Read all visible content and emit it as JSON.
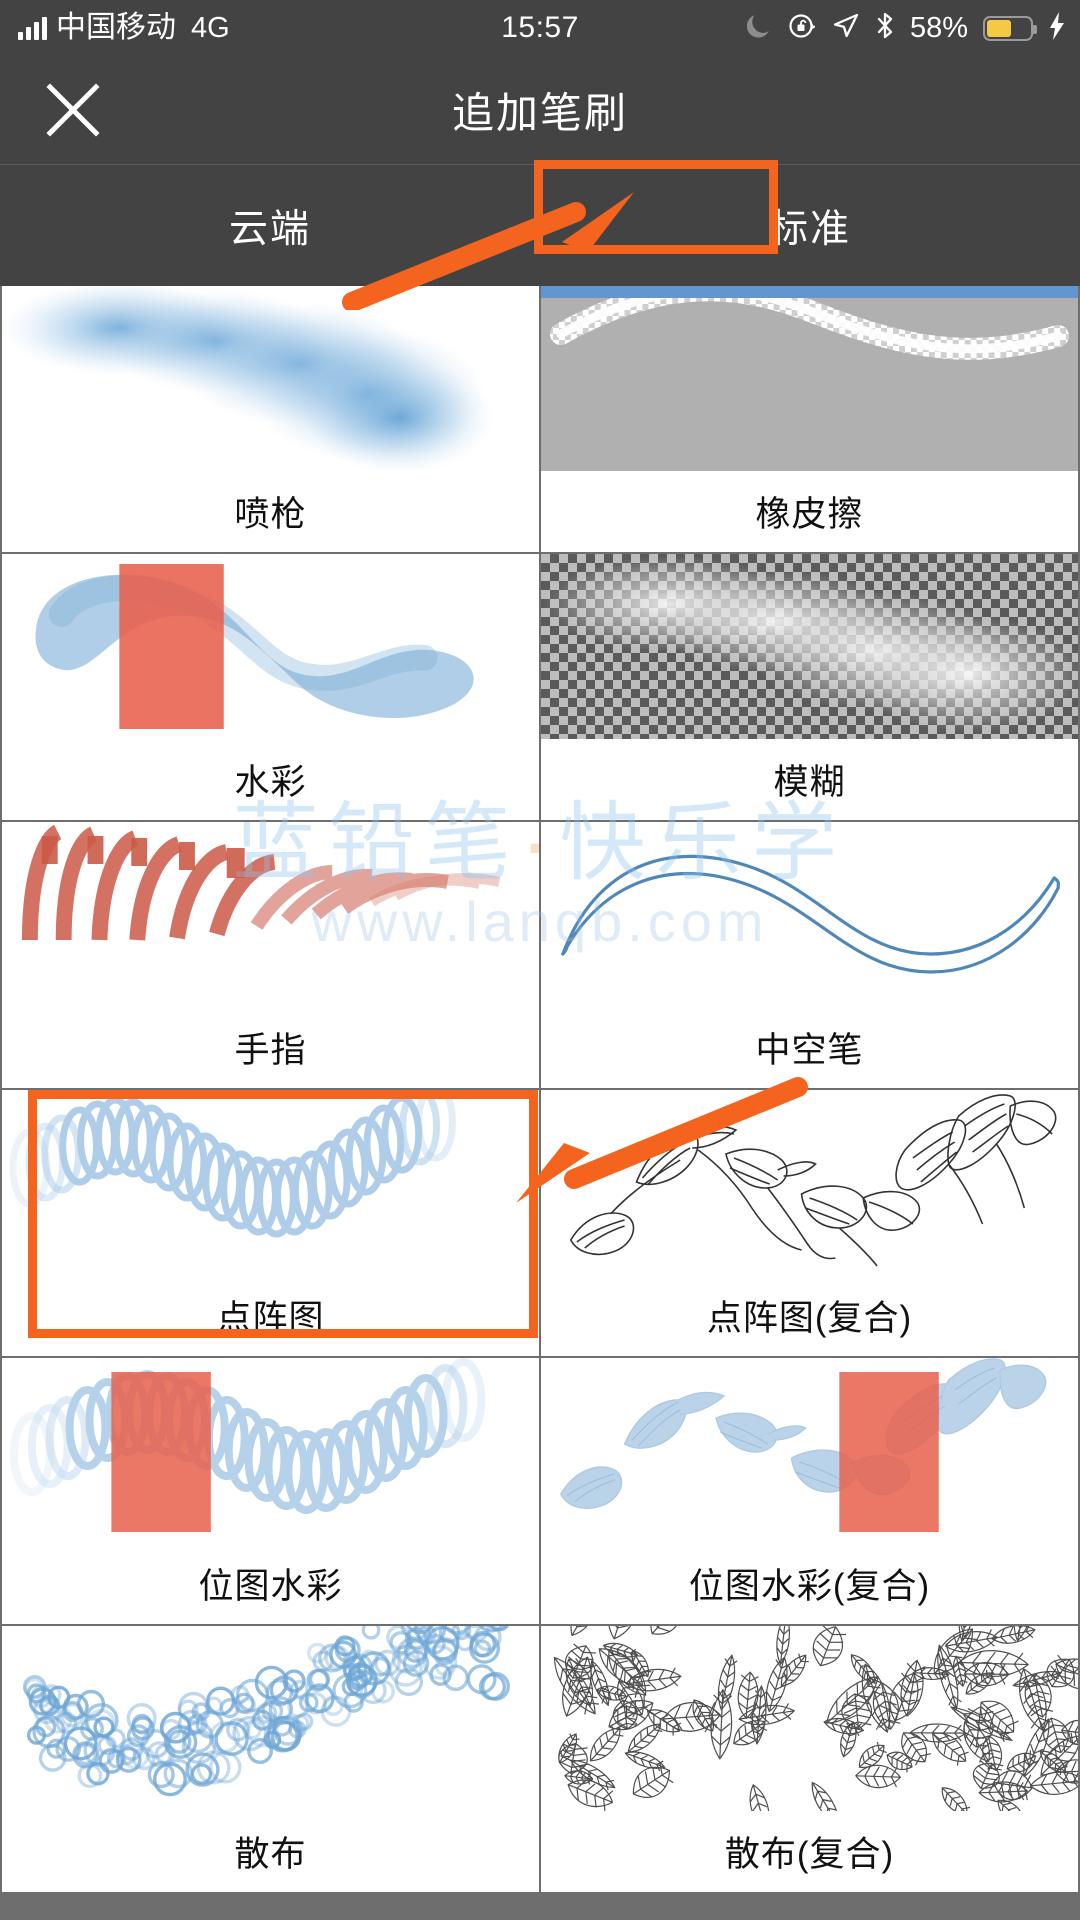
{
  "statusbar": {
    "carrier": "中国移动",
    "network": "4G",
    "time": "15:57",
    "battery_percent": "58%",
    "battery_fill_color": "#f6c944",
    "icons": [
      "signal-bars-icon",
      "moon-icon",
      "rotation-lock-icon",
      "location-arrow-icon",
      "bluetooth-icon",
      "battery-icon",
      "charging-bolt-icon"
    ]
  },
  "navbar": {
    "close_label": "×",
    "title": "追加笔刷"
  },
  "tabs": [
    {
      "label": "云端",
      "selected": false
    },
    {
      "label": "标准",
      "selected": true
    }
  ],
  "colors": {
    "bar_background": "#434343",
    "grid_line": "#6e6e6e",
    "accent_annotation": "#f4641e",
    "selection_bar": "#6196ce",
    "brush_blue": "#6ea6d6",
    "brush_red": "#e8604c"
  },
  "watermark": {
    "line1": "蓝铅笔·快乐学",
    "line2": "www.lanqb.com"
  },
  "brushes": [
    {
      "label": "喷枪",
      "thumb": "airbrush",
      "background": "white",
      "selected": false
    },
    {
      "label": "橡皮擦",
      "thumb": "eraser",
      "background": "gray",
      "selected": true
    },
    {
      "label": "水彩",
      "thumb": "watercolor",
      "background": "white",
      "selected": false
    },
    {
      "label": "模糊",
      "thumb": "blur",
      "background": "checker",
      "selected": false
    },
    {
      "label": "手指",
      "thumb": "smudge",
      "background": "white",
      "selected": false
    },
    {
      "label": "中空笔",
      "thumb": "hollow-pen",
      "background": "white",
      "selected": false
    },
    {
      "label": "点阵图",
      "thumb": "bitmap",
      "background": "white",
      "selected": false
    },
    {
      "label": "点阵图(复合)",
      "thumb": "bitmap-composite",
      "background": "white",
      "selected": false
    },
    {
      "label": "位图水彩",
      "thumb": "bitmap-watercolor",
      "background": "white",
      "selected": false
    },
    {
      "label": "位图水彩(复合)",
      "thumb": "bitmap-watercolor-composite",
      "background": "white",
      "selected": false
    },
    {
      "label": "散布",
      "thumb": "scatter",
      "background": "white",
      "selected": false
    },
    {
      "label": "散布(复合)",
      "thumb": "scatter-composite",
      "background": "white",
      "selected": false
    }
  ],
  "annotations": {
    "tab_highlight_target": "标准",
    "cell_highlight_target": "点阵图"
  }
}
